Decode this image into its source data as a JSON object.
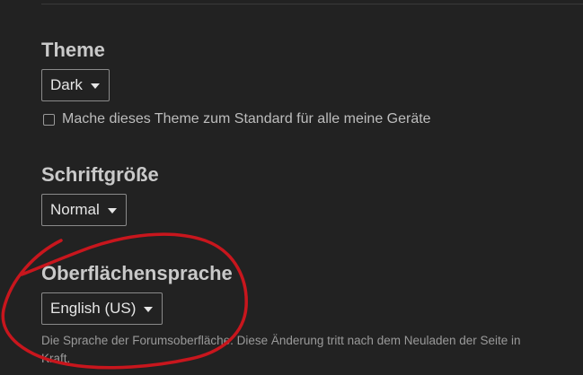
{
  "theme_section": {
    "title": "Theme",
    "dropdown_value": "Dark",
    "default_checkbox_label": "Mache dieses Theme zum Standard für alle meine Geräte",
    "default_checkbox_checked": false
  },
  "font_size_section": {
    "title": "Schriftgröße",
    "dropdown_value": "Normal"
  },
  "interface_language_section": {
    "title": "Oberflächensprache",
    "dropdown_value": "English (US)",
    "description": "Die Sprache der Forumsoberfläche. Diese Änderung tritt nach dem Neuladen der Seite in Kraft."
  },
  "annotation": {
    "color": "#c8161d"
  },
  "icons": {
    "dropdown_caret": "caret-down-icon",
    "checkbox": "checkbox-unchecked-icon"
  },
  "colors": {
    "background": "#222222",
    "heading": "#c9c9c9",
    "control_border": "#8a8a8a",
    "muted_text": "#9a9a9a"
  }
}
